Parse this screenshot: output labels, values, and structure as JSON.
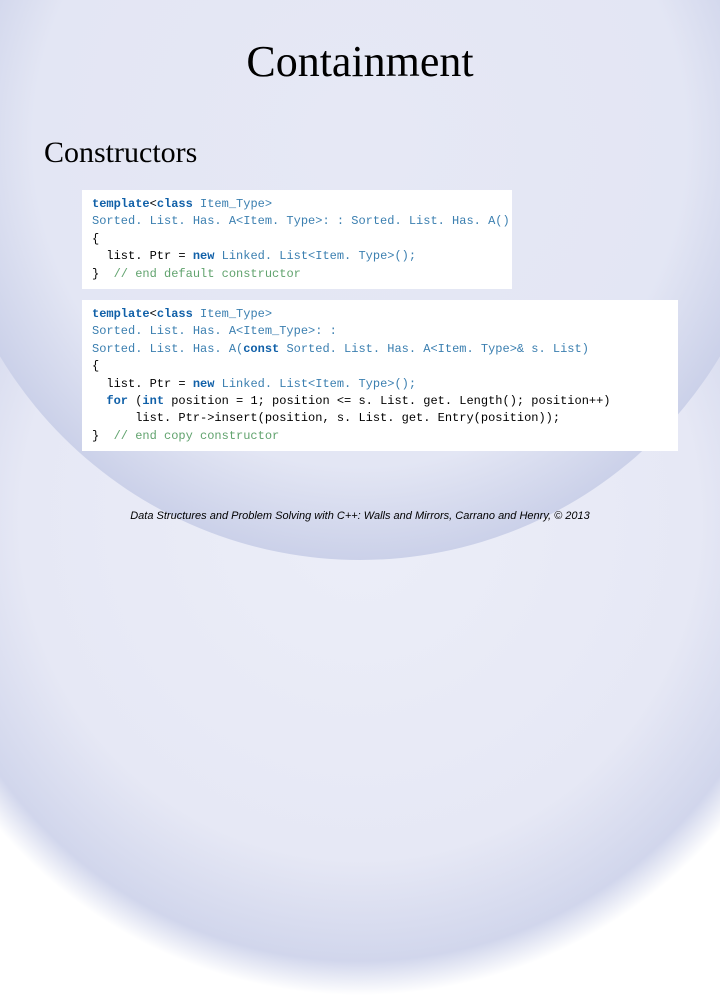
{
  "slide": {
    "title": "Containment",
    "subtitle": "Constructors",
    "footer": "Data Structures and Problem Solving with C++: Walls and Mirrors, Carrano and Henry, ©  2013"
  },
  "code1": {
    "l1a": "template",
    "l1b": "<",
    "l1c": "class",
    "l1d": " Item_Type>",
    "l2": "Sorted. List. Has. A<Item. Type>: : Sorted. List. Has. A()",
    "l3": "{",
    "l4a": "  list. Ptr = ",
    "l4b": "new",
    "l4c": " Linked. List<Item. Type>();",
    "l5a": "}  ",
    "l5b": "// end default constructor"
  },
  "code2": {
    "l1a": "template",
    "l1b": "<",
    "l1c": "class",
    "l1d": " Item_Type>",
    "l2": "Sorted. List. Has. A<Item_Type>: :",
    "l3a": "Sorted. List. Has. A(",
    "l3b": "const",
    "l3c": " Sorted. List. Has. A<Item. Type>& s. List)",
    "l4": "{",
    "l5a": "  list. Ptr = ",
    "l5b": "new",
    "l5c": " Linked. List<Item. Type>();",
    "l6a": "  ",
    "l6b": "for",
    "l6c": " (",
    "l6d": "int",
    "l6e": " position = 1; position <= s. List. get. Length(); position++)",
    "l7": "      list. Ptr->insert(position, s. List. get. Entry(position));",
    "l8a": "}  ",
    "l8b": "// end copy constructor"
  }
}
